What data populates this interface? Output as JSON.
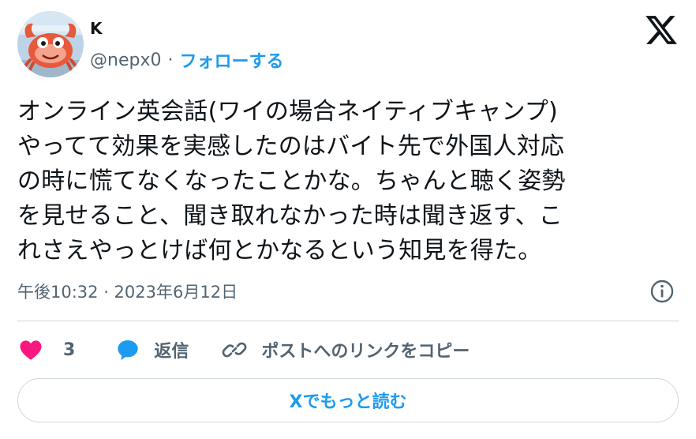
{
  "author": {
    "name": "K",
    "handle": "@nepx0",
    "separator": "·",
    "follow_label": "フォローする"
  },
  "tweet": {
    "lines": [
      "オンライン英会話(ワイの場合ネイティブキャンプ)",
      "やってて効果を実感したのはバイト先で外国人対応",
      "の時に慌てなくなったことかな。ちゃんと聴く姿勢",
      "を見せること、聞き取れなかった時は聞き返す、こ",
      "れさえやっとけば何とかなるという知見を得た。"
    ],
    "timestamp": "午後10:32 · 2023年6月12日"
  },
  "actions": {
    "like_count": "3",
    "reply_label": "返信",
    "copy_link_label": "ポストへのリンクをコピー"
  },
  "read_more_label": "Xでもっと読む",
  "colors": {
    "accent": "#1d9bf0",
    "like": "#f91880",
    "muted": "#536471",
    "border": "#cfd9de"
  },
  "icons": {
    "logo": "x-logo-icon",
    "info": "info-icon",
    "like": "heart-icon",
    "reply": "speech-bubble-icon",
    "copy": "link-icon"
  }
}
